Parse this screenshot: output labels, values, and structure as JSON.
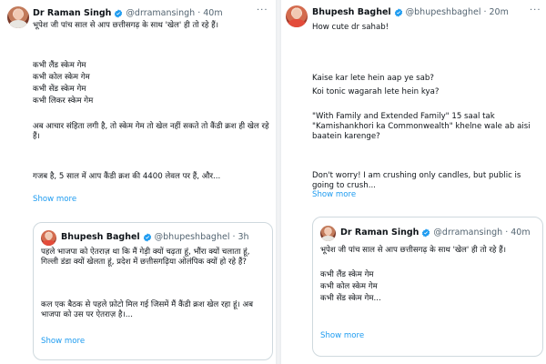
{
  "left": {
    "author": {
      "name": "Dr Raman Singh",
      "handle": "@drramansingh",
      "time": "· 40m"
    },
    "lines": [
      "भूपेश जी पांच साल से आप छत्तीसगढ़ के साथ 'खेल' ही तो रहे हैं।",
      "कभी लैंड स्केम गेम",
      "कभी कोल स्केम गेम",
      "कभी सेंड स्केम गेम",
      "कभी लिकर स्केम गेम",
      "अब आचार संहिता लगी है, तो स्केम गेम तो खेल नहीं सकते तो कैंडी क्रश ही खेल रहे हैं।",
      "गजब है, 5 साल में आप कैंडी क्रश की 4400 लेवल पर हैं, और..."
    ],
    "show_more": "Show more",
    "quote": {
      "author": {
        "name": "Bhupesh Baghel",
        "handle": "@bhupeshbaghel",
        "time": "· 3h"
      },
      "lines": [
        "पहले भाजपा को ऐतराज़ था कि मैं गेड़ी क्यों चढ़ता हूं, भौंरा क्यों चलाता हूं, गिल्ली डंडा क्यों खेलता हूं, प्रदेश में छत्तीसगढ़िया ओलंपिक क्यों हो रहे हैं?",
        "कल एक बैठक से पहले फ़ोटो मिल गई जिसमें मैं कैंडी क्रश खेल रहा हूं। अब भाजपा को उस पर ऐतराज़ है।..."
      ],
      "show_more": "Show more"
    }
  },
  "right": {
    "author": {
      "name": "Bhupesh Baghel",
      "handle": "@bhupeshbaghel",
      "time": "· 20m"
    },
    "lines": [
      "How cute dr sahab!",
      "Kaise kar lete hein aap ye sab?",
      "Koi tonic wagarah lete hein kya?",
      "\"With Family and Extended Family\" 15 saal tak \"Kamishankhori ka Commonwealth\" khelne wale ab aisi baatein karenge?",
      "Don't worry! I am crushing only candles, but public is going to crush..."
    ],
    "show_more": "Show more",
    "quote": {
      "author": {
        "name": "Dr Raman Singh",
        "handle": "@drramansingh",
        "time": "· 40m"
      },
      "lines": [
        "भूपेश जी पांच साल से आप छत्तीसगढ़ के साथ 'खेल' ही तो रहे हैं।",
        "कभी लैंड स्केम गेम",
        "कभी कोल स्केम गेम",
        "कभी सेंड स्केम गेम..."
      ],
      "show_more": "Show more"
    }
  },
  "colors": {
    "text": "#0f1419",
    "muted": "#536471",
    "link": "#1d9bf0",
    "verified": "#1d9bf0",
    "border": "#cfd9de"
  },
  "icons": {
    "verified": "verified-badge-icon",
    "more": "more-options-icon"
  }
}
